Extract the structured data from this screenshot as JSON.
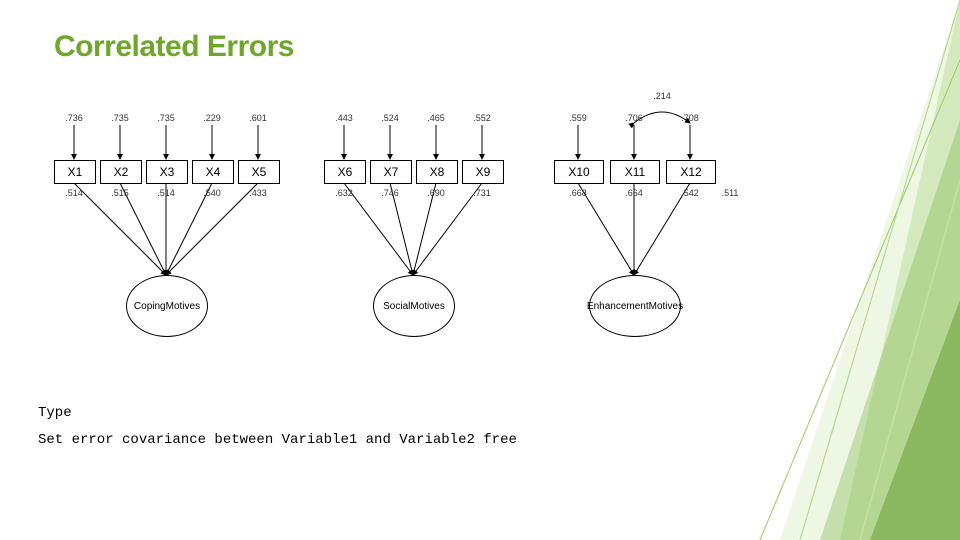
{
  "title": "Correlated Errors",
  "code": {
    "line1": "Type",
    "line2": "Set error covariance between Variable1 and Variable2 free"
  },
  "diagram": {
    "correlation_label": ".214",
    "vars": [
      {
        "name": "X1",
        "err": ".736",
        "load": ".514"
      },
      {
        "name": "X2",
        "err": ".735",
        "load": ".515"
      },
      {
        "name": "X3",
        "err": ".735",
        "load": ".514"
      },
      {
        "name": "X4",
        "err": ".229",
        "load": ".540"
      },
      {
        "name": "X5",
        "err": ".601",
        "load": ".433"
      },
      {
        "name": "X6",
        "err": ".443",
        "load": ".632"
      },
      {
        "name": "X7",
        "err": ".524",
        "load": ".746"
      },
      {
        "name": "X8",
        "err": ".465",
        "load": ".690"
      },
      {
        "name": "X9",
        "err": ".552",
        "load": ".731"
      },
      {
        "name": "X10",
        "err": ".559",
        "load": ".668"
      },
      {
        "name": "X11",
        "err": ".706",
        "load": ".664"
      },
      {
        "name": "X12",
        "err": ".708",
        "load": ".542"
      }
    ],
    "extra_load_x12": ".511",
    "factors": [
      {
        "label": "Coping\nMotives"
      },
      {
        "label": "Social\nMotives"
      },
      {
        "label": "Enhancement\nMotives"
      }
    ]
  }
}
